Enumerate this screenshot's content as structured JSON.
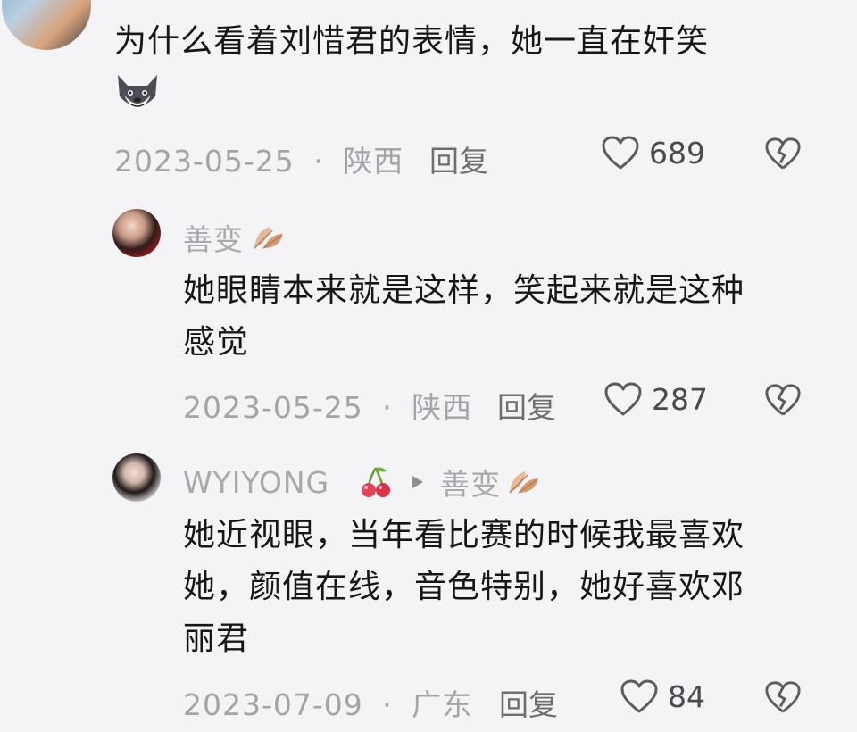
{
  "comments": [
    {
      "text": "为什么看着刘惜君的表情，她一直在奸笑",
      "emoji": "wolf-face-emoji",
      "date": "2023-05-25",
      "location": "陕西",
      "reply_label": "回复",
      "likes": "689"
    },
    {
      "username": "善变",
      "user_badge": "leaf-icon",
      "text_line1": "她眼睛本来就是这样，笑起来就是这种",
      "text_line2": "感觉",
      "date": "2023-05-25",
      "location": "陕西",
      "reply_label": "回复",
      "likes": "287"
    },
    {
      "username": "WYIYONG",
      "user_badge": "cherry-icon",
      "reply_to": "善变",
      "reply_to_badge": "leaf-icon",
      "text_line1": "她近视眼，当年看比赛的时候我最喜欢",
      "text_line2": "她，颜值在线，音色特别，她好喜欢邓",
      "text_line3": "丽君",
      "date": "2023-07-09",
      "location": "广东",
      "reply_label": "回复",
      "likes": "84"
    }
  ],
  "separator": "·",
  "colors": {
    "background": "#f4f4f6",
    "meta_text": "#a3a3a8",
    "body_text": "#161616"
  }
}
